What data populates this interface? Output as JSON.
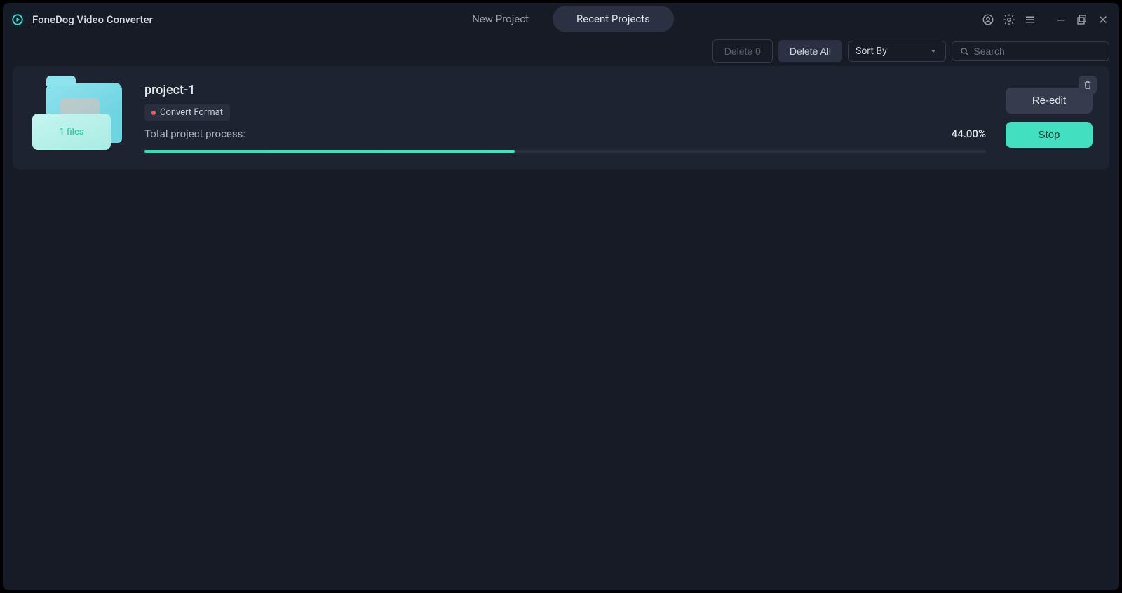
{
  "app": {
    "title": "FoneDog Video Converter"
  },
  "tabs": {
    "new_project": "New Project",
    "recent_projects": "Recent Projects"
  },
  "toolbar": {
    "delete0": "Delete 0",
    "delete_all": "Delete All",
    "sort_by": "Sort By",
    "search_placeholder": "Search"
  },
  "project": {
    "name": "project-1",
    "files_label": "1 files",
    "tag": "Convert Format",
    "progress_label": "Total project process:",
    "progress_pct": "44.00%",
    "progress_value": 44,
    "reedit": "Re-edit",
    "stop": "Stop"
  }
}
